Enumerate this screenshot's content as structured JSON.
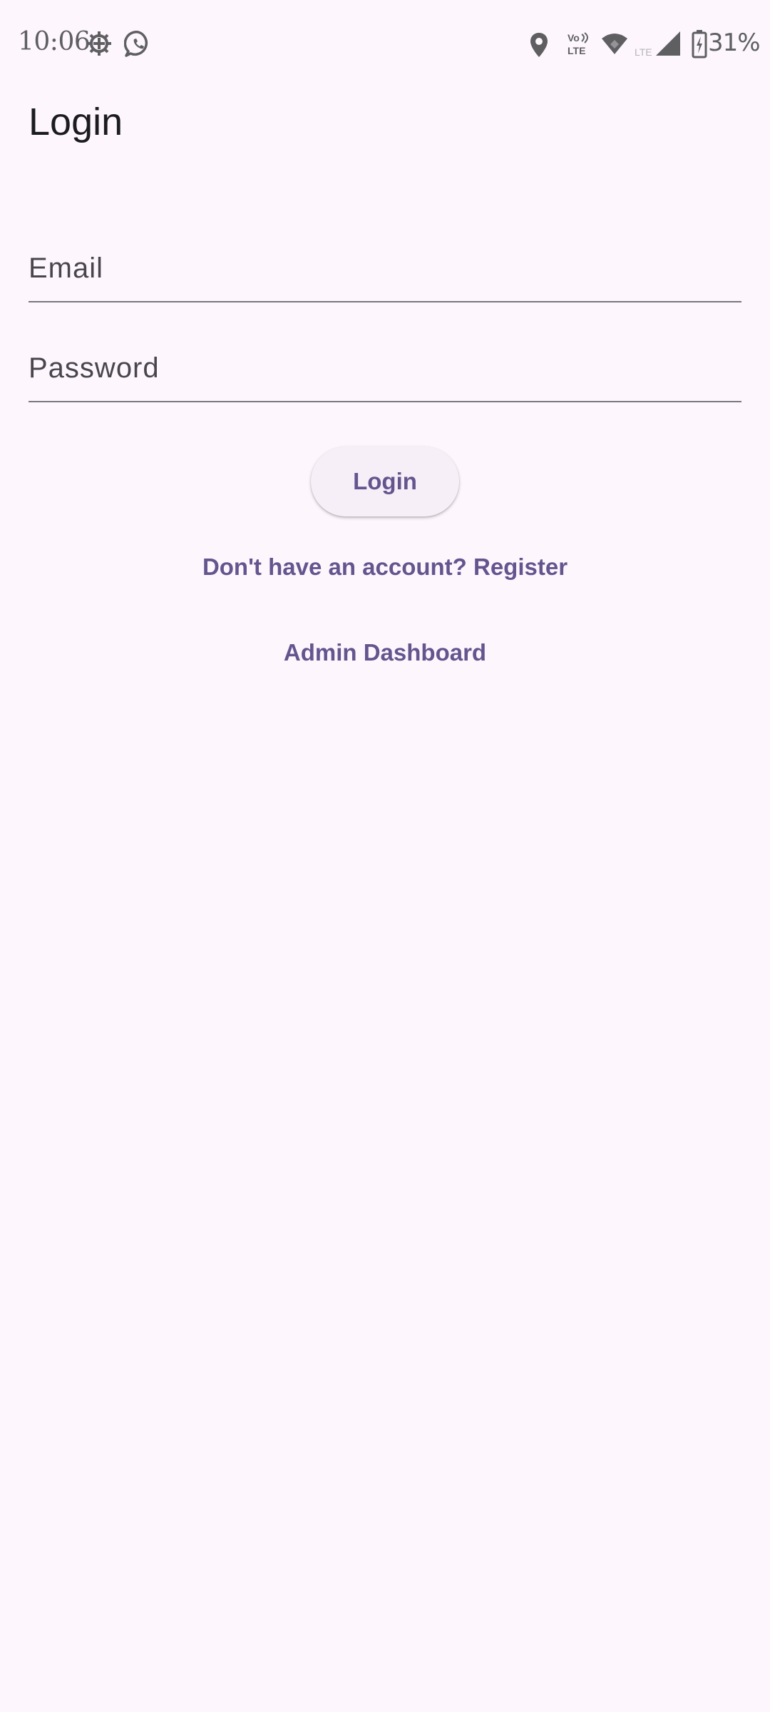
{
  "status_bar": {
    "time": "10:06",
    "battery_percent": "31%",
    "icons_left": [
      "settings-gear-icon",
      "whatsapp-icon"
    ],
    "icons_right": [
      "location-pin-icon",
      "volte-icon",
      "wifi-icon",
      "lte-signal-icon",
      "battery-charging-icon"
    ],
    "volte_top": "Vo",
    "volte_bottom": "LTE",
    "lte_label": "LTE"
  },
  "app_bar": {
    "title": "Login"
  },
  "form": {
    "email": {
      "placeholder": "Email",
      "value": ""
    },
    "password": {
      "placeholder": "Password",
      "value": ""
    },
    "login_button_label": "Login"
  },
  "links": {
    "register": "Don't have an account? Register",
    "admin_dashboard": "Admin Dashboard"
  },
  "colors": {
    "background": "#fdf7fd",
    "primary": "#65558f",
    "button_surface": "#f6eff7",
    "outline": "#7a757f",
    "on_surface": "#1c1b1f",
    "on_surface_variant": "#49454f"
  }
}
